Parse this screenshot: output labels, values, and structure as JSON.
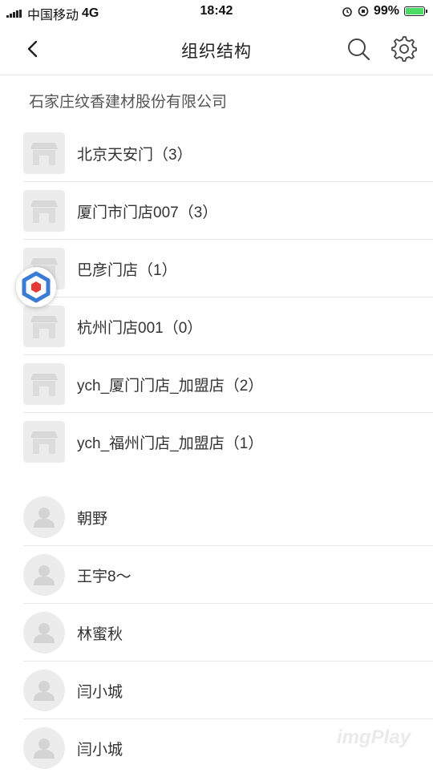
{
  "status_bar": {
    "carrier": "中国移动",
    "network": "4G",
    "time": "18:42",
    "battery": "99%"
  },
  "nav": {
    "title": "组织结构"
  },
  "company_name": "石家庄纹香建材股份有限公司",
  "stores": [
    {
      "label": "北京天安门（3）"
    },
    {
      "label": "厦门市门店007（3）"
    },
    {
      "label": "巴彦门店（1）"
    },
    {
      "label": "杭州门店001（0）"
    },
    {
      "label": "ych_厦门门店_加盟店（2）"
    },
    {
      "label": "ych_福州门店_加盟店（1）"
    }
  ],
  "people": [
    {
      "label": "朝野"
    },
    {
      "label": "王宇8～"
    },
    {
      "label": "林蜜秋"
    },
    {
      "label": "闫小城"
    },
    {
      "label": "闫小城"
    }
  ],
  "watermark": "imgPlay",
  "colors": {
    "battery_fill": "#4cd964",
    "float_icon_blue": "#3a7bd5",
    "float_icon_red": "#e53935"
  }
}
